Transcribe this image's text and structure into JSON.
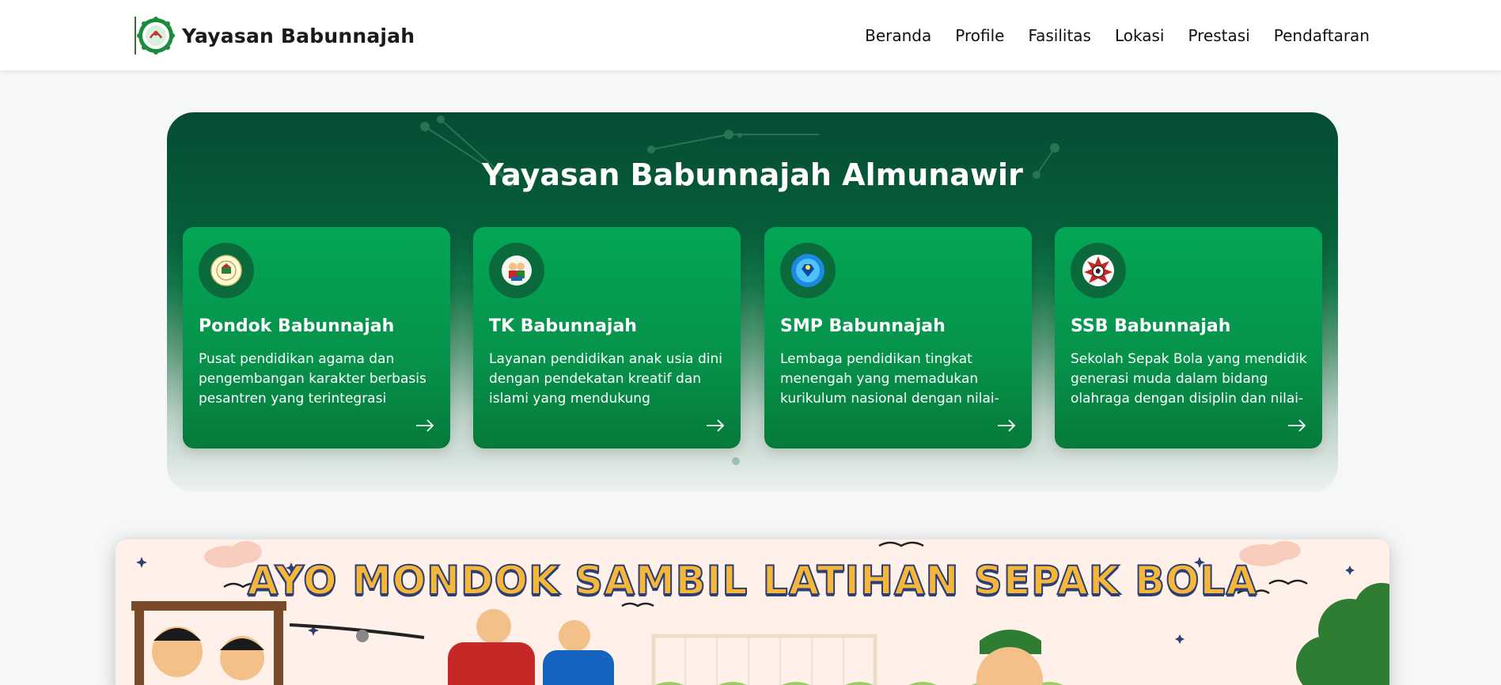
{
  "brand": {
    "name": "Yayasan Babunnajah"
  },
  "nav": [
    {
      "label": "Beranda"
    },
    {
      "label": "Profile"
    },
    {
      "label": "Fasilitas"
    },
    {
      "label": "Lokasi"
    },
    {
      "label": "Prestasi"
    },
    {
      "label": "Pendaftaran"
    }
  ],
  "hero": {
    "title": "Yayasan Babunnajah Almunawir",
    "cards": [
      {
        "title": "Pondok Babunnajah",
        "description": "Pusat pendidikan agama dan pengembangan karakter berbasis pesantren yang terintegrasi secara...",
        "icon": "pondok-logo-icon"
      },
      {
        "title": "TK Babunnajah",
        "description": "Layanan pendidikan anak usia dini dengan pendekatan kreatif dan islami yang mendukung perkembangan aw...",
        "icon": "tk-logo-icon"
      },
      {
        "title": "SMP Babunnajah",
        "description": "Lembaga pendidikan tingkat menengah yang memadukan kurikulum nasional dengan nilai-nilai...",
        "icon": "smp-logo-icon"
      },
      {
        "title": "SSB Babunnajah",
        "description": "Sekolah Sepak Bola yang mendidik generasi muda dalam bidang olahraga dengan disiplin dan nilai-nilai islami.",
        "icon": "ssb-logo-icon"
      }
    ]
  },
  "banner": {
    "text": "AYO MONDOK SAMBIL LATIHAN SEPAK BOLA"
  },
  "colors": {
    "primary": "#065f3a",
    "card": "#03a656",
    "banner_text": "#f5b63c"
  }
}
